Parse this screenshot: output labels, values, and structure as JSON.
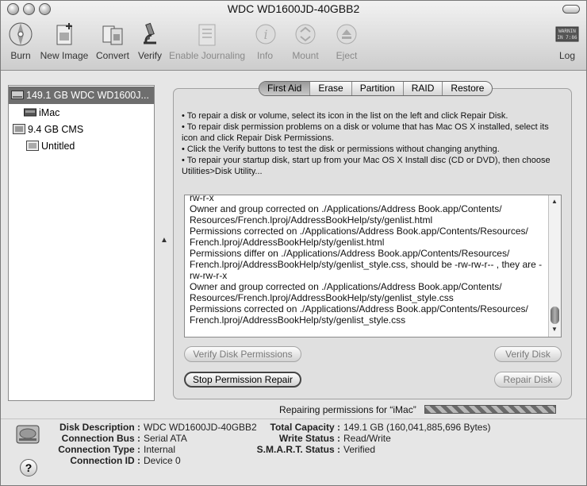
{
  "window": {
    "title": "WDC WD1600JD-40GBB2"
  },
  "toolbar": {
    "burn": "Burn",
    "new_image": "New Image",
    "convert": "Convert",
    "verify": "Verify",
    "enable_journaling": "Enable Journaling",
    "info": "Info",
    "mount": "Mount",
    "eject": "Eject",
    "log": "Log",
    "log_icon_text": "WARNIN\nIN 7:86"
  },
  "sidebar": {
    "items": [
      {
        "label": "149.1 GB WDC WD1600J..."
      },
      {
        "label": "iMac"
      },
      {
        "label": "9.4 GB CMS"
      },
      {
        "label": "Untitled"
      }
    ]
  },
  "tabs": [
    "First Aid",
    "Erase",
    "Partition",
    "RAID",
    "Restore"
  ],
  "instructions": [
    "• To repair a disk or volume, select its icon in the list on the left and click Repair Disk.",
    "• To repair disk permission problems on a disk or volume that has Mac OS X installed, select its icon and click Repair Disk Permissions.",
    "• Click the Verify buttons to test the disk or permissions without changing anything.",
    "• To repair your startup disk, start up from your Mac OS X Install disc (CD or DVD), then choose Utilities>Disk Utility..."
  ],
  "log_lines": [
    "rw-r-x",
    "Owner and group corrected on ./Applications/Address Book.app/Contents/ Resources/French.lproj/AddressBookHelp/sty/genlist.html",
    "Permissions corrected on ./Applications/Address Book.app/Contents/Resources/ French.lproj/AddressBookHelp/sty/genlist.html",
    "Permissions differ on ./Applications/Address Book.app/Contents/Resources/ French.lproj/AddressBookHelp/sty/genlist_style.css, should be -rw-rw-r-- , they are -rw-rw-r-x",
    "Owner and group corrected on ./Applications/Address Book.app/Contents/ Resources/French.lproj/AddressBookHelp/sty/genlist_style.css",
    "Permissions corrected on ./Applications/Address Book.app/Contents/Resources/ French.lproj/AddressBookHelp/sty/genlist_style.css"
  ],
  "buttons": {
    "verify_permissions": "Verify Disk Permissions",
    "verify_disk": "Verify Disk",
    "stop_repair": "Stop Permission Repair",
    "repair_disk": "Repair Disk"
  },
  "progress": {
    "label": "Repairing permissions for “iMac”",
    "fraction": 1.0
  },
  "info": {
    "left": [
      {
        "key": "Disk Description :",
        "value": "WDC WD1600JD-40GBB2"
      },
      {
        "key": "Connection Bus :",
        "value": "Serial ATA"
      },
      {
        "key": "Connection Type :",
        "value": "Internal"
      },
      {
        "key": "Connection ID :",
        "value": "Device 0"
      }
    ],
    "right": [
      {
        "key": "Total Capacity :",
        "value": "149.1 GB (160,041,885,696 Bytes)"
      },
      {
        "key": "Write Status :",
        "value": "Read/Write"
      },
      {
        "key": "S.M.A.R.T. Status :",
        "value": "Verified"
      }
    ]
  },
  "help": "?"
}
